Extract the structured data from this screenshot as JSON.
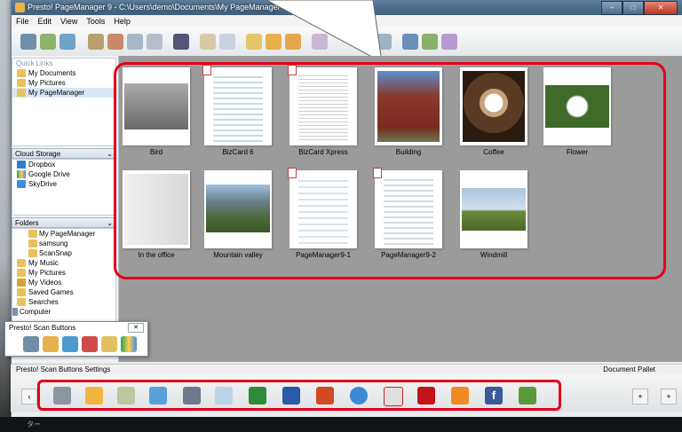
{
  "window": {
    "title": "Presto! PageManager 9 - C:\\Users\\demo\\Documents\\My PageManager"
  },
  "menu": [
    "File",
    "Edit",
    "View",
    "Tools",
    "Help"
  ],
  "left_panel": {
    "quick_links": {
      "header": "Quick Links",
      "items": [
        {
          "label": "My Documents",
          "icon": "documents-icon"
        },
        {
          "label": "My Pictures",
          "icon": "pictures-icon"
        },
        {
          "label": "My PageManager",
          "icon": "pagemanager-icon"
        }
      ]
    },
    "cloud_storage": {
      "header": "Cloud Storage",
      "items": [
        {
          "label": "Dropbox",
          "icon": "dropbox-icon"
        },
        {
          "label": "Google Drive",
          "icon": "google-drive-icon"
        },
        {
          "label": "SkyDrive",
          "icon": "skydrive-icon"
        }
      ]
    },
    "folders": {
      "header": "Folders",
      "items": [
        {
          "label": "My PageManager",
          "icon": "folder-icon",
          "indent": 1
        },
        {
          "label": "samsung",
          "icon": "folder-icon",
          "indent": 1
        },
        {
          "label": "ScanSnap",
          "icon": "folder-icon",
          "indent": 1
        },
        {
          "label": "My Music",
          "icon": "music-folder-icon",
          "indent": 0
        },
        {
          "label": "My Pictures",
          "icon": "pictures-folder-icon",
          "indent": 0
        },
        {
          "label": "My Videos",
          "icon": "videos-folder-icon",
          "indent": 0
        },
        {
          "label": "Saved Games",
          "icon": "games-folder-icon",
          "indent": 0
        },
        {
          "label": "Searches",
          "icon": "search-folder-icon",
          "indent": 0
        },
        {
          "label": "Computer",
          "icon": "computer-icon",
          "indent": -1
        }
      ]
    }
  },
  "scan_buttons_panel": {
    "title": "Presto! Scan Buttons",
    "icons": [
      "scanner-icon",
      "folder-scan-icon",
      "ocr-icon",
      "pdf-scan-icon",
      "photo-scan-icon",
      "google-drive-scan-icon"
    ]
  },
  "documents": [
    {
      "name": "Bird",
      "kind": "photo"
    },
    {
      "name": "BizCard 6",
      "kind": "pdf"
    },
    {
      "name": "BizCard Xpress",
      "kind": "pdf"
    },
    {
      "name": "Building",
      "kind": "photo"
    },
    {
      "name": "Coffee",
      "kind": "photo"
    },
    {
      "name": "Flower",
      "kind": "photo"
    },
    {
      "name": "In the office",
      "kind": "photo"
    },
    {
      "name": "Mountain valley",
      "kind": "photo"
    },
    {
      "name": "PageManager9-1",
      "kind": "pdf"
    },
    {
      "name": "PageManager9-2",
      "kind": "pdf"
    },
    {
      "name": "Windmill",
      "kind": "photo"
    }
  ],
  "bottom": {
    "scan_settings_label": "Presto! Scan Buttons Settings",
    "document_pallet_label": "Document Pallet",
    "pallet_icons": [
      "scanner-icon",
      "mail-icon",
      "paint-icon",
      "scan-send-icon",
      "printer-icon",
      "document-viewer-icon",
      "excel-icon",
      "word-icon",
      "powerpoint-icon",
      "internet-explorer-icon",
      "acrobat-reader-icon",
      "acrobat-icon",
      "photo-app-icon",
      "facebook-icon",
      "evernote-icon"
    ]
  },
  "taskbar": {
    "text": "ター"
  },
  "colors": {
    "highlight": "#e2001a",
    "content_bg": "#9b9b9b"
  }
}
